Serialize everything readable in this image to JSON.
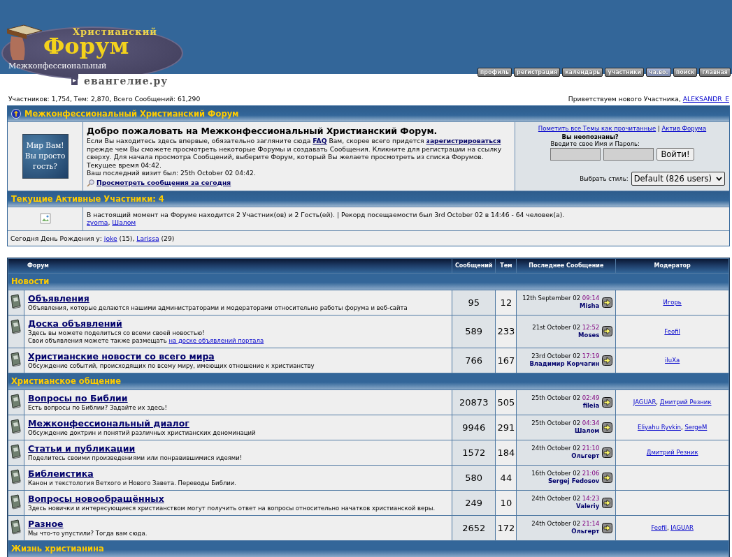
{
  "header": {
    "logo": {
      "top_line": "Христианский",
      "main": "Форум",
      "subtitle": "Межконфессиональный",
      "arrow": "▸",
      "site": "евангелие.ру"
    },
    "nav": [
      {
        "label": "профиль",
        "selected": false
      },
      {
        "label": "регистрация",
        "selected": false
      },
      {
        "label": "календарь",
        "selected": false
      },
      {
        "label": "участники",
        "selected": false
      },
      {
        "label": "ча.во.",
        "selected": true
      },
      {
        "label": "поиск",
        "selected": false
      },
      {
        "label": "главная",
        "selected": false
      }
    ]
  },
  "stats": "Участников: 1,754, Тем: 2,870, Всего Сообщений: 61,290",
  "greeting": [
    {
      "kind": "text",
      "text": "Приветствуем нового Участника, "
    },
    {
      "kind": "link",
      "text": "ALEKSANDR_E"
    }
  ],
  "info_panel": {
    "title": "Межконфессиональный Христианский Форум",
    "banner": [
      "Мир Вам!",
      "Вы просто",
      "гость?"
    ],
    "welcome": {
      "heading": "Добро пожаловать на Межконфессиональный Христианский Форум.",
      "intro": [
        {
          "kind": "text",
          "text": "Если Вы находитесь здесь впервые, обязательно загляните сюда "
        },
        {
          "kind": "strong_link",
          "text": "FAQ"
        },
        {
          "kind": "text",
          "text": " Вам, скорее всего придется "
        },
        {
          "kind": "strong_link",
          "text": "зарегистрироваться"
        },
        {
          "kind": "text",
          "text": " прежде чем Вы сможете просмотреть некоторые Форумы и создавать Сообщения. Кликните для регистрации на ссылку сверху. Для начала просмотра Сообщений, выберите Форум, который Вы желаете просмотреть из списка Форумов."
        }
      ],
      "time": "Текущее время 04:42.",
      "last_visit": "Ваш последний визит был: 25th October 02 04:42.",
      "today_link": "Просмотреть сообщения за сегодня"
    },
    "login": {
      "links": [
        {
          "kind": "link",
          "text": "Пометить все Темы как прочитанные"
        },
        {
          "kind": "text",
          "text": " | "
        },
        {
          "kind": "link",
          "text": "Актив Форума"
        }
      ],
      "prompt": "Вы неопознаны?",
      "hint": "Введите свое Имя и Пароль:",
      "button": "Войти!",
      "style_label": "Выбрать стиль:",
      "style_value": "Default (826 users)"
    },
    "active_title": "Текущие Активные Участники: 4",
    "active_text": "В настоящий момент на Форуме находится 2 Участник(ов) и 2 Гость(ей). | Рекорд посещаемости был 3rd October 02 в 14:46 - 64 человек(а).",
    "online_users": [
      {
        "kind": "link",
        "text": "zyoma"
      },
      {
        "kind": "text",
        "text": ", "
      },
      {
        "kind": "link",
        "text": "Шалом"
      }
    ],
    "birthdays": [
      {
        "kind": "text",
        "text": "Сегодня День Рождения у: "
      },
      {
        "kind": "link",
        "text": "joke"
      },
      {
        "kind": "text",
        "text": " (15), "
      },
      {
        "kind": "link",
        "text": "Larissa"
      },
      {
        "kind": "text",
        "text": " (29)"
      }
    ]
  },
  "forum_table": {
    "columns": [
      "Форум",
      "Сообщений",
      "Тем",
      "Последнее Сообщение",
      "Модератор"
    ],
    "categories": [
      {
        "name": "Новости",
        "forums": [
          {
            "title": "Объявления",
            "description": [
              {
                "text": "Объявления, которые делаются нашими администраторами и модераторами относительно работы форума и веб-сайта"
              }
            ],
            "posts": "95",
            "topics": "12",
            "last": {
              "date": "12th September 02",
              "time": "09:14",
              "author": "Misha"
            },
            "moderators": [
              {
                "kind": "link",
                "text": "Игорь"
              }
            ]
          },
          {
            "title": "Доска объявлений",
            "description": [
              {
                "text": "Здесь вы можете поделиться со всеми своей новостью!"
              },
              {
                "text": "Свои объявления можете также размещать ",
                "link": "на доске объявлений портала"
              }
            ],
            "posts": "589",
            "topics": "233",
            "last": {
              "date": "21st October 02",
              "time": "12:52",
              "author": "Moses"
            },
            "moderators": [
              {
                "kind": "link",
                "text": "Feofil"
              }
            ]
          },
          {
            "title": "Христианские новости со всего мира",
            "description": [
              {
                "text": "Обсуждение событий, происходящих по всему миру, имеющих отношение к христианству"
              }
            ],
            "posts": "766",
            "topics": "167",
            "last": {
              "date": "23rd October 02",
              "time": "17:19",
              "author": "Владимир Корчагин"
            },
            "moderators": [
              {
                "kind": "link",
                "text": "iluXa"
              }
            ]
          }
        ]
      },
      {
        "name": "Христианское общение",
        "forums": [
          {
            "title": "Вопросы по Библии",
            "description": [
              {
                "text": "Есть вопросы по Библии? Задайте их здесь!"
              }
            ],
            "posts": "20873",
            "topics": "505",
            "last": {
              "date": "25th October 02",
              "time": "02:49",
              "author": "fileia"
            },
            "moderators": [
              {
                "kind": "link",
                "text": "JAGUAR"
              },
              {
                "kind": "text",
                "text": ", "
              },
              {
                "kind": "link",
                "text": "Дмитрий Резник"
              }
            ]
          },
          {
            "title": "Межконфессиональный диалог",
            "description": [
              {
                "text": "Обсуждение доктрин и понятий различных христианских деноминаций"
              }
            ],
            "posts": "9946",
            "topics": "291",
            "last": {
              "date": "25th October 02",
              "time": "04:34",
              "author": "Шалом"
            },
            "moderators": [
              {
                "kind": "link",
                "text": "Eliyahu Ryvkin"
              },
              {
                "kind": "text",
                "text": ", "
              },
              {
                "kind": "link",
                "text": "SergeM"
              }
            ]
          },
          {
            "title": "Статьи и публикации",
            "description": [
              {
                "text": "Поделитесь своими произведениями или понравившимися идеями!"
              }
            ],
            "posts": "1572",
            "topics": "184",
            "last": {
              "date": "24th October 02",
              "time": "21:10",
              "author": "Ольгерт"
            },
            "moderators": [
              {
                "kind": "link",
                "text": "Дмитрий Резник"
              }
            ]
          },
          {
            "title": "Библеистика",
            "description": [
              {
                "text": "Канон и текстология Ветхого и Нового Завета. Переводы Библии."
              }
            ],
            "posts": "580",
            "topics": "44",
            "last": {
              "date": "16th October 02",
              "time": "21:06",
              "author": "Sergej Fedosov"
            }
          },
          {
            "title": "Вопросы новообращённых",
            "description": [
              {
                "text": "Здесь новички и интересующиеся христианством могут получить ответ на вопросы относительно начатков христианской веры."
              }
            ],
            "posts": "249",
            "topics": "10",
            "last": {
              "date": "24th October 02",
              "time": "14:23",
              "author": "Valeriy"
            }
          },
          {
            "title": "Разное",
            "description": [
              {
                "text": "Мы что-то упустили? Тогда вам сюда."
              }
            ],
            "posts": "2652",
            "topics": "172",
            "last": {
              "date": "24th October 02",
              "time": "21:14",
              "author": "Ольгерт"
            },
            "moderators": [
              {
                "kind": "link",
                "text": "Feofil"
              },
              {
                "kind": "text",
                "text": ", "
              },
              {
                "kind": "link",
                "text": "JAGUAR"
              }
            ]
          }
        ]
      },
      {
        "name": "Жизнь христианина"
      }
    ]
  }
}
